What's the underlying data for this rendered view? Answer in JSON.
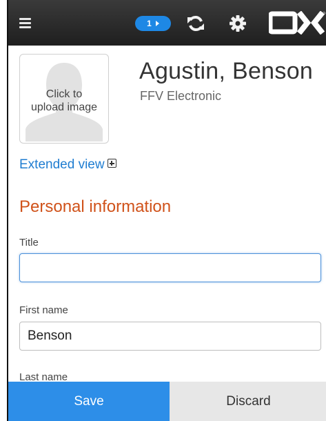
{
  "topbar": {
    "menu_icon": "hamburger-menu-icon",
    "badge_count": "1",
    "refresh_icon": "refresh-icon",
    "settings_icon": "gear-icon",
    "logo_text": "OX"
  },
  "contact": {
    "photo_label_line1": "Click to",
    "photo_label_line2": "upload image",
    "full_name": "Agustin, Benson",
    "company": "FFV Electronic"
  },
  "extended_view": {
    "label": "Extended view",
    "icon": "plus-square-icon"
  },
  "section": {
    "title": "Personal information"
  },
  "fields": {
    "title": {
      "label": "Title",
      "value": ""
    },
    "first_name": {
      "label": "First name",
      "value": "Benson"
    },
    "last_name": {
      "label": "Last name"
    }
  },
  "actions": {
    "save": "Save",
    "discard": "Discard"
  },
  "colors": {
    "topbar": "#2b2b2b",
    "accent_blue": "#1e88e5",
    "link_blue": "#1f7dd1",
    "section_orange": "#d0521a",
    "save_bg": "#2d8ee8",
    "discard_bg": "#e7e7e7"
  }
}
